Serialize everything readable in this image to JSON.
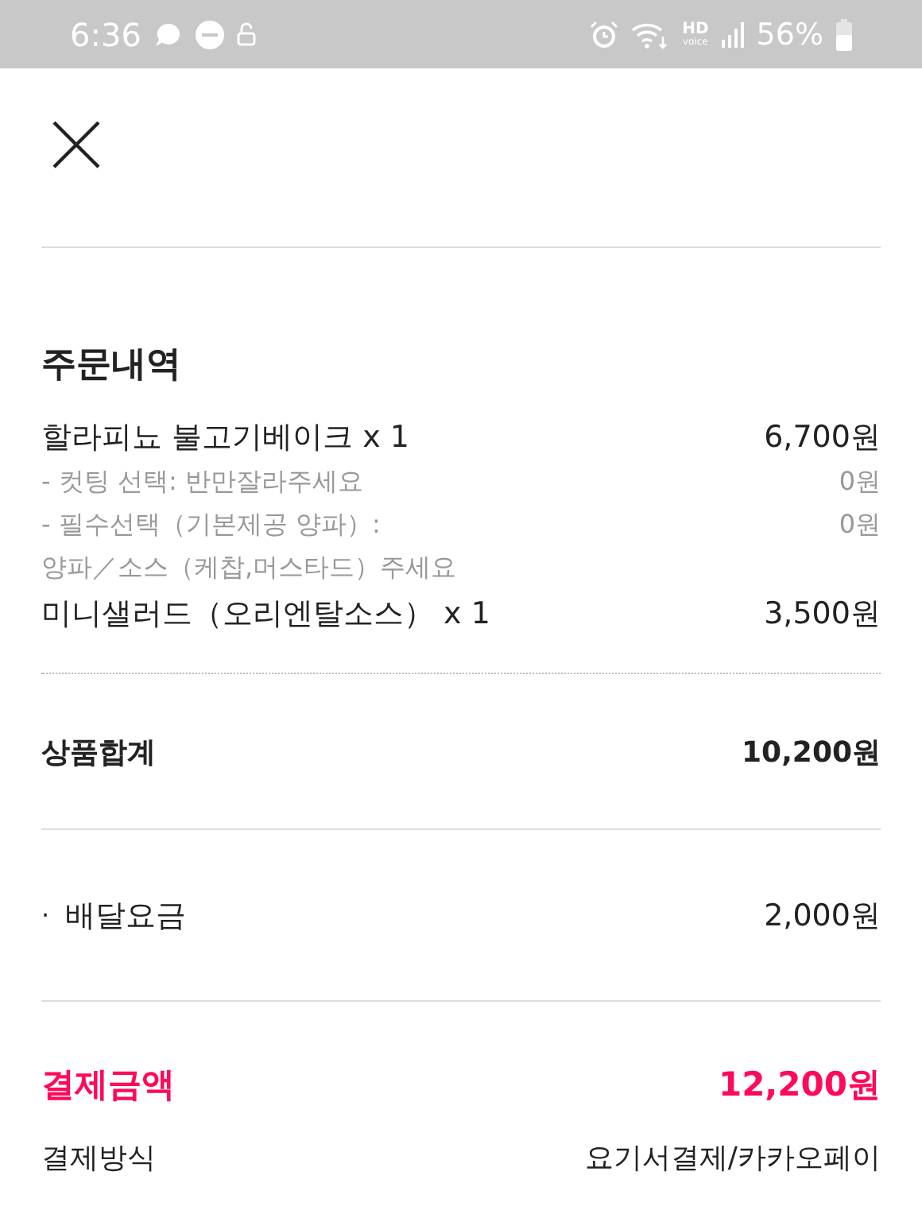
{
  "status_bar": {
    "time": "6:36",
    "hd": "HD",
    "voice": "voice",
    "battery": "56%"
  },
  "section_title": "주문내역",
  "items": [
    {
      "name": "할라피뇨 불고기베이크 x 1",
      "price": "6,700원",
      "options": [
        {
          "lines": [
            "- 컷팅 선택: 반만잘라주세요"
          ],
          "price": "0원"
        },
        {
          "lines": [
            "- 필수선택（기본제공 양파）:",
            "양파／소스（케찹,머스타드）주세요"
          ],
          "price": "0원"
        }
      ]
    },
    {
      "name": "미니샐러드（오리엔탈소스） x 1",
      "price": "3,500원"
    }
  ],
  "subtotal": {
    "label": "상품합계",
    "value": "10,200원"
  },
  "delivery": {
    "bullet": "·",
    "label": "배달요금",
    "value": "2,000원"
  },
  "total": {
    "label": "결제금액",
    "value": "12,200원"
  },
  "payment": {
    "label": "결제방식",
    "value": "요기서결제/카카오페이"
  }
}
